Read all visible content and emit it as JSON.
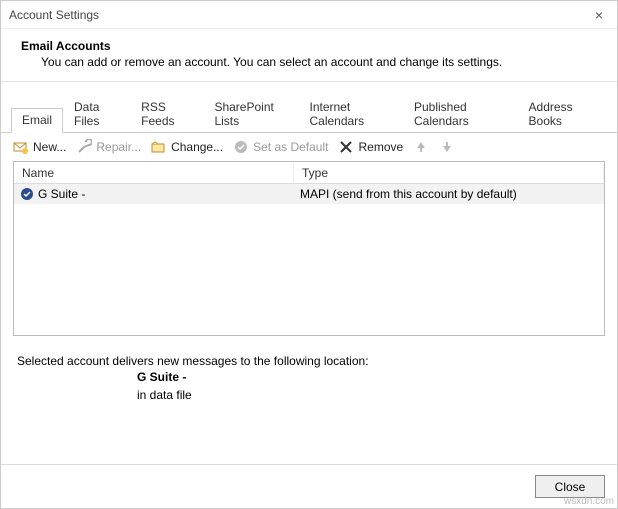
{
  "window": {
    "title": "Account Settings"
  },
  "header": {
    "title": "Email Accounts",
    "description": "You can add or remove an account. You can select an account and change its settings."
  },
  "tabs": [
    {
      "label": "Email",
      "active": true
    },
    {
      "label": "Data Files"
    },
    {
      "label": "RSS Feeds"
    },
    {
      "label": "SharePoint Lists"
    },
    {
      "label": "Internet Calendars"
    },
    {
      "label": "Published Calendars"
    },
    {
      "label": "Address Books"
    }
  ],
  "toolbar": {
    "new_label": "New...",
    "repair_label": "Repair...",
    "change_label": "Change...",
    "default_label": "Set as Default",
    "remove_label": "Remove"
  },
  "table": {
    "columns": {
      "name": "Name",
      "type": "Type"
    },
    "rows": [
      {
        "name": "G Suite -",
        "type": "MAPI (send from this account by default)"
      }
    ]
  },
  "footer": {
    "intro": "Selected account delivers new messages to the following location:",
    "line1": "G Suite -",
    "line2": "in data file"
  },
  "buttons": {
    "close": "Close"
  },
  "watermark": "wsxdn.com"
}
